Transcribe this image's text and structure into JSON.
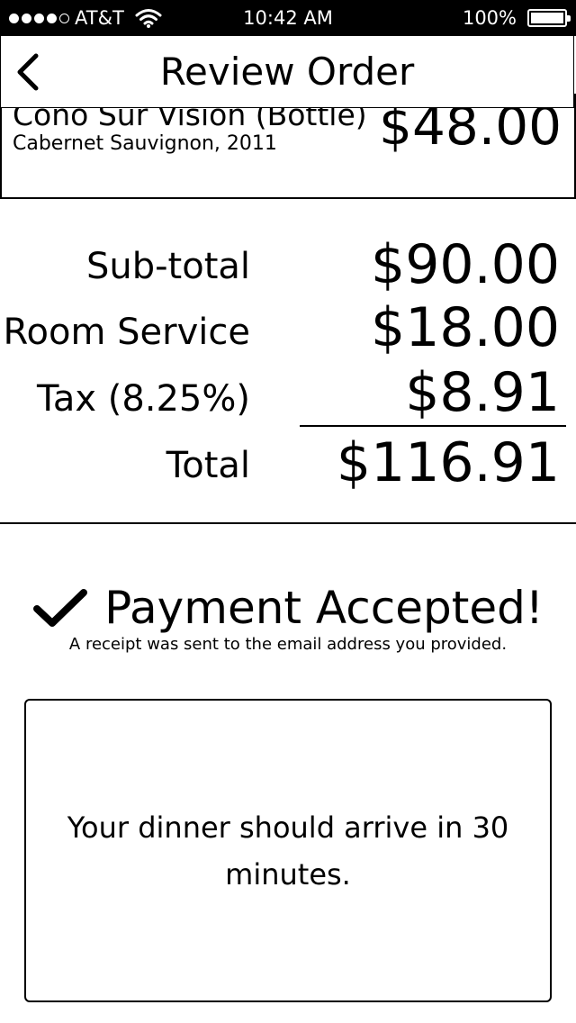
{
  "status_bar": {
    "signal_dots": 5,
    "signal_filled": 4,
    "carrier": "AT&T",
    "time": "10:42 AM",
    "battery_percent": "100%",
    "battery_level": 1.0
  },
  "nav": {
    "title": "Review Order",
    "back_icon": "chevron-left-icon"
  },
  "order_item": {
    "name": "Cono Sur Vision (Bottle)",
    "subtitle": "Cabernet Sauvignon, 2011",
    "price": "$48.00"
  },
  "totals": {
    "subtotal_label": "Sub-total",
    "subtotal_value": "$90.00",
    "room_service_label": "Room Service",
    "room_service_value": "$18.00",
    "tax_label": "Tax (8.25%)",
    "tax_value": "$8.91",
    "total_label": "Total",
    "total_value": "$116.91"
  },
  "payment": {
    "icon": "checkmark-icon",
    "title": "Payment Accepted!",
    "note": "A receipt was sent to the email address you provided."
  },
  "message": {
    "text": "Your dinner should arrive in 30 minutes."
  },
  "colors": {
    "status_bar_bg": "#000000",
    "background": "#ffffff",
    "text": "#000000"
  }
}
